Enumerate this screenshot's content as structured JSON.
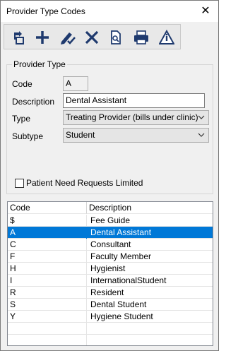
{
  "window": {
    "title": "Provider Type Codes"
  },
  "toolbar": {
    "buttons": [
      {
        "name": "refresh-icon"
      },
      {
        "name": "add-icon"
      },
      {
        "name": "edit-icon"
      },
      {
        "name": "delete-icon"
      },
      {
        "name": "preview-icon"
      },
      {
        "name": "print-icon"
      },
      {
        "name": "info-icon"
      }
    ]
  },
  "form": {
    "group_label": "Provider Type",
    "code_label": "Code",
    "code_value": "A",
    "description_label": "Description",
    "description_value": "Dental Assistant",
    "type_label": "Type",
    "type_value": "Treating Provider (bills under clinic)",
    "subtype_label": "Subtype",
    "subtype_value": "Student",
    "checkbox_label": "Patient Need Requests Limited",
    "checkbox_checked": false
  },
  "table": {
    "headers": [
      "Code",
      "Description"
    ],
    "rows": [
      {
        "code": "$",
        "description": "Fee Guide"
      },
      {
        "code": "A",
        "description": "Dental Assistant",
        "selected": true
      },
      {
        "code": "C",
        "description": "Consultant"
      },
      {
        "code": "F",
        "description": "Faculty Member"
      },
      {
        "code": "H",
        "description": "Hygienist"
      },
      {
        "code": "I",
        "description": "InternationalStudent"
      },
      {
        "code": "R",
        "description": "Resident"
      },
      {
        "code": "S",
        "description": "Dental Student"
      },
      {
        "code": "Y",
        "description": "Hygiene Student"
      }
    ],
    "empty_rows": 2
  },
  "colors": {
    "selection": "#0078d7",
    "icon": "#1f3a6e"
  }
}
